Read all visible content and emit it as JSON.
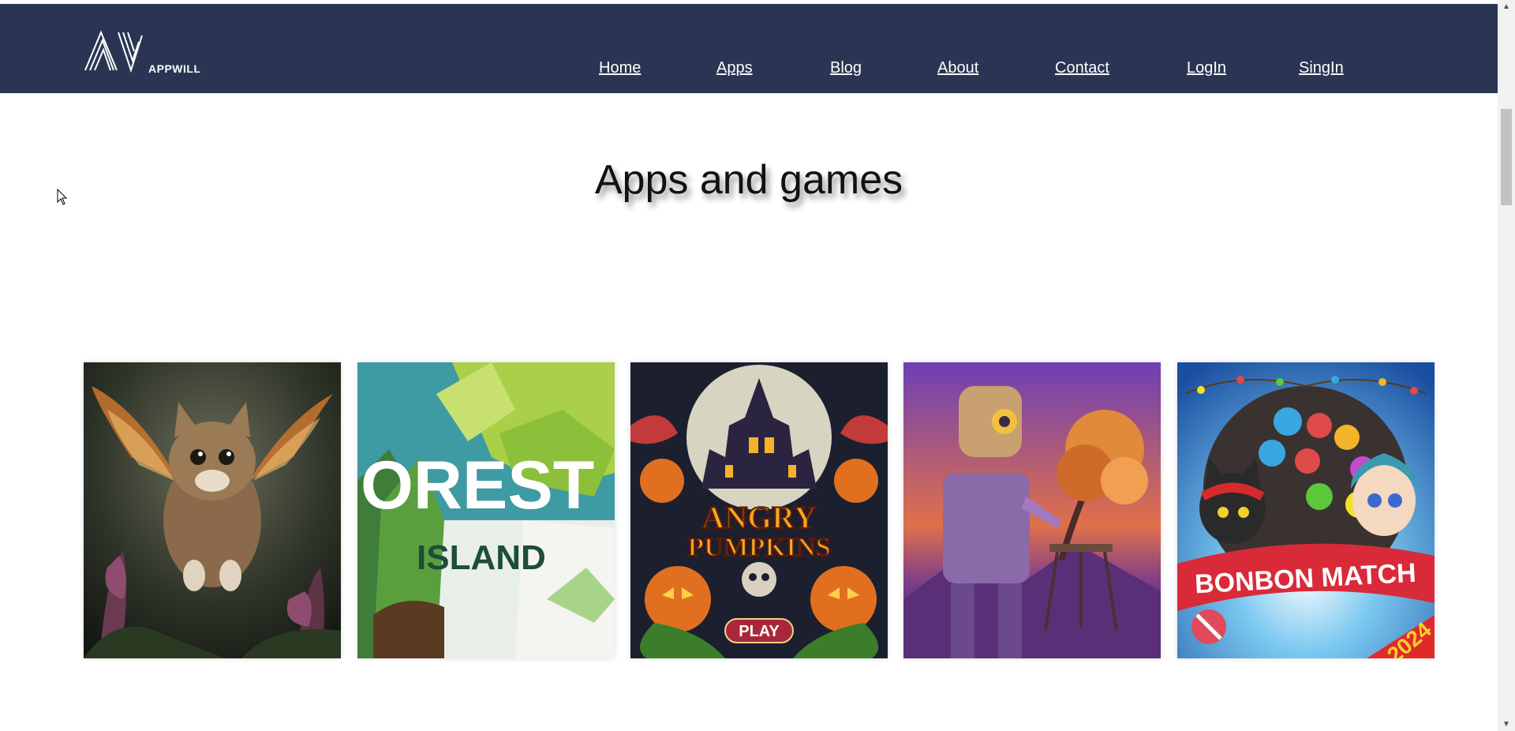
{
  "header": {
    "logo_text": "APPWILL",
    "nav": [
      {
        "label": "Home"
      },
      {
        "label": "Apps"
      },
      {
        "label": "Blog"
      },
      {
        "label": "About"
      },
      {
        "label": "Contact"
      },
      {
        "label": "LogIn"
      },
      {
        "label": "SingIn"
      }
    ]
  },
  "main": {
    "title": "Apps and games",
    "cards": [
      {
        "icon": "flying-cat-image"
      },
      {
        "icon": "forest-island-image",
        "art_text": [
          "OREST",
          "ISLAND"
        ]
      },
      {
        "icon": "angry-pumpkins-image",
        "art_text": [
          "ANGRY",
          "PUMPKINS",
          "PLAY"
        ]
      },
      {
        "icon": "robot-painter-image"
      },
      {
        "icon": "bonbon-match-image",
        "art_text": [
          "BONBON MATCH",
          "2024"
        ]
      }
    ]
  },
  "colors": {
    "header_bg": "#293553",
    "nav_text": "#ffffff",
    "title_text": "#111111"
  }
}
